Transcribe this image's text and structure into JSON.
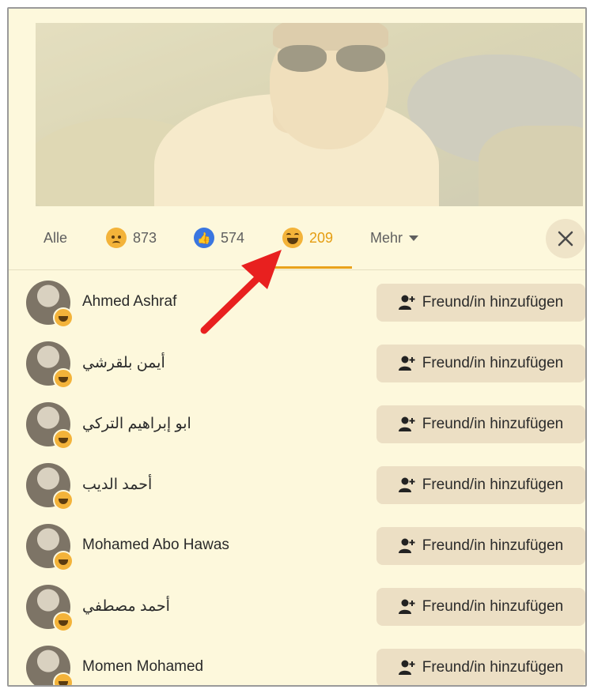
{
  "tabs": {
    "all": "Alle",
    "sad_count": "873",
    "like_count": "574",
    "haha_count": "209",
    "more": "Mehr"
  },
  "icons": {
    "sad": "sad-reaction-icon",
    "like": "like-reaction-icon",
    "haha": "haha-reaction-icon",
    "close": "close-icon",
    "add_friend": "add-friend-icon"
  },
  "colors": {
    "background": "#fdf8dc",
    "active_tab": "#e59d11",
    "button_bg": "#ecdfc4",
    "annotation_arrow": "#e8201f"
  },
  "people": [
    {
      "name": "Ahmed Ashraf",
      "action": "Freund/in hinzufügen"
    },
    {
      "name": "أيمن بلقرشي",
      "action": "Freund/in hinzufügen"
    },
    {
      "name": "ابو إبراهيم التركي",
      "action": "Freund/in hinzufügen"
    },
    {
      "name": "أحمد الديب",
      "action": "Freund/in hinzufügen"
    },
    {
      "name": "Mohamed Abo Hawas",
      "action": "Freund/in hinzufügen"
    },
    {
      "name": "أحمد مصطفي",
      "action": "Freund/in hinzufügen"
    },
    {
      "name": "Momen Mohamed",
      "action": "Freund/in hinzufügen"
    }
  ]
}
